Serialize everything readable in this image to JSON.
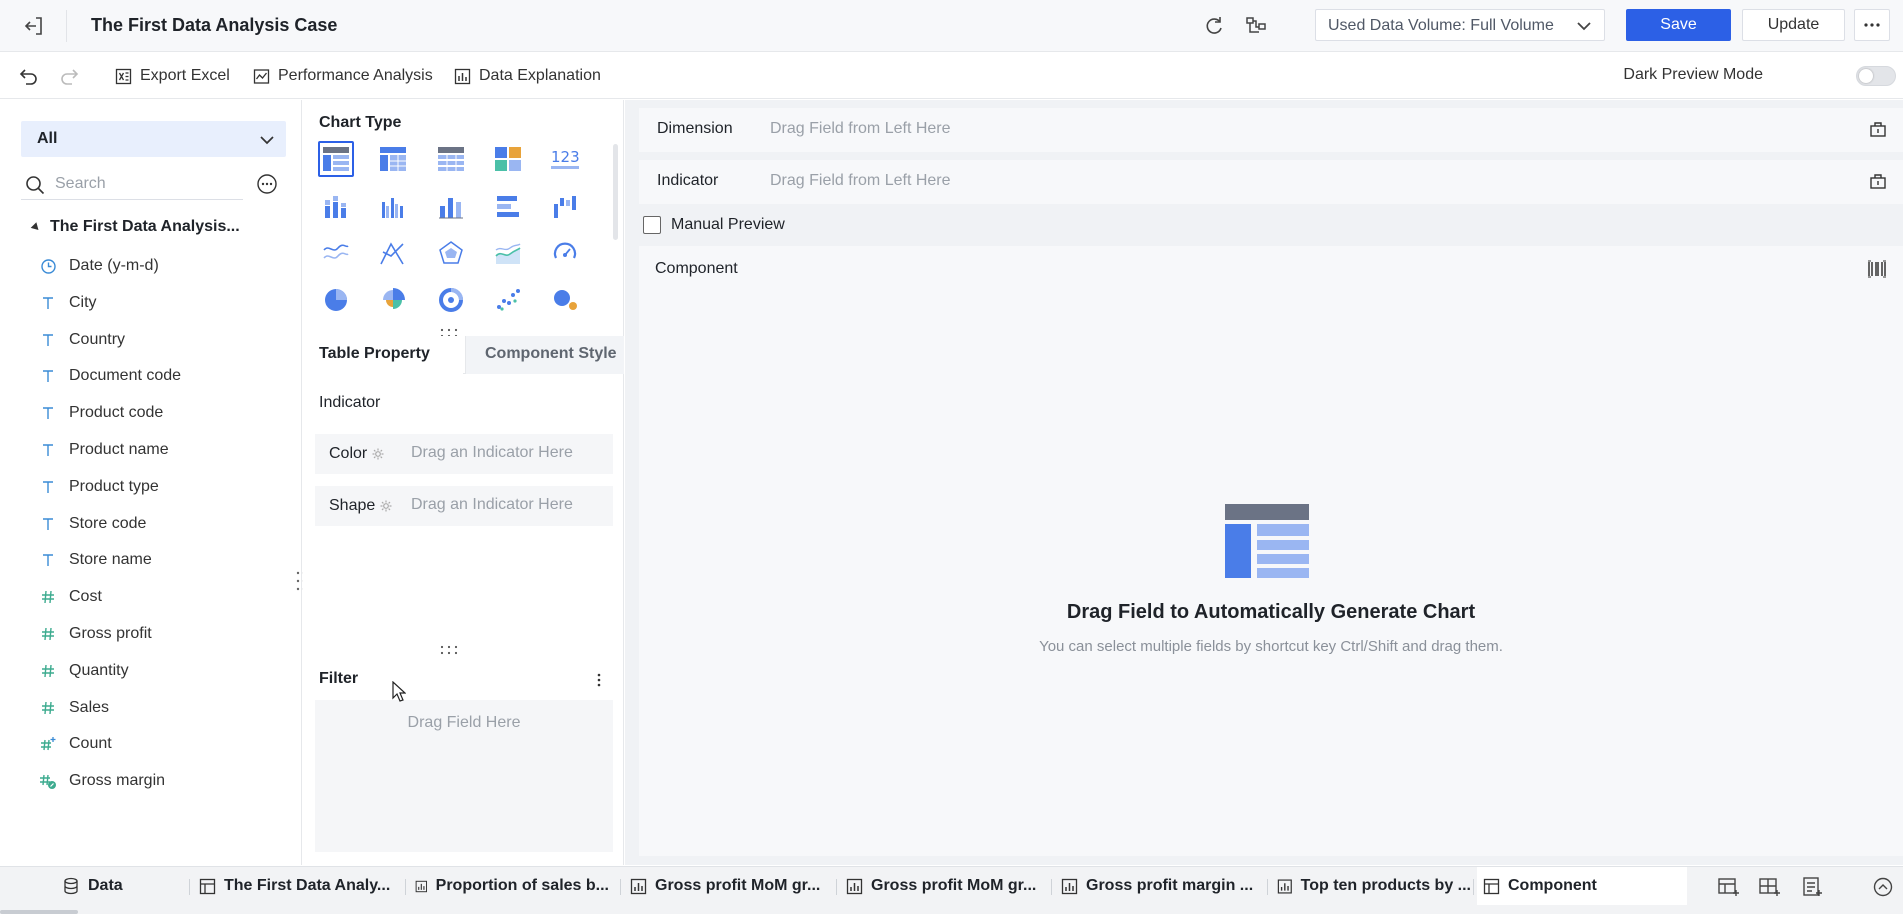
{
  "header": {
    "title": "The First Data Analysis Case",
    "data_volume_label": "Used Data Volume: Full Volume",
    "save_label": "Save",
    "update_label": "Update"
  },
  "toolbar": {
    "export_excel": "Export Excel",
    "performance_analysis": "Performance Analysis",
    "data_explanation": "Data Explanation",
    "dark_preview_mode": "Dark Preview Mode",
    "dark_preview_enabled": false
  },
  "fields_panel": {
    "datasource_selected": "All",
    "search_placeholder": "Search",
    "table_name": "The First Data Analysis...",
    "fields": [
      {
        "label": "Date (y-m-d)",
        "type": "date",
        "icon": "clock-icon"
      },
      {
        "label": "City",
        "type": "text",
        "icon": "text-type-icon"
      },
      {
        "label": "Country",
        "type": "text",
        "icon": "text-type-icon"
      },
      {
        "label": "Document code",
        "type": "text",
        "icon": "text-type-icon"
      },
      {
        "label": "Product code",
        "type": "text",
        "icon": "text-type-icon"
      },
      {
        "label": "Product name",
        "type": "text",
        "icon": "text-type-icon"
      },
      {
        "label": "Product type",
        "type": "text",
        "icon": "text-type-icon"
      },
      {
        "label": "Store code",
        "type": "text",
        "icon": "text-type-icon"
      },
      {
        "label": "Store name",
        "type": "text",
        "icon": "text-type-icon"
      },
      {
        "label": "Cost",
        "type": "number",
        "icon": "hash-icon"
      },
      {
        "label": "Gross profit",
        "type": "number",
        "icon": "hash-icon"
      },
      {
        "label": "Quantity",
        "type": "number",
        "icon": "hash-icon"
      },
      {
        "label": "Sales",
        "type": "number",
        "icon": "hash-icon"
      },
      {
        "label": "Count",
        "type": "calc-number",
        "icon": "hash-plus-icon"
      },
      {
        "label": "Gross margin",
        "type": "calc-number",
        "icon": "hash-calc-icon"
      }
    ]
  },
  "chart_panel": {
    "chart_type_label": "Chart Type",
    "chart_types": [
      "table-icon",
      "cross-table-icon",
      "detail-table-icon",
      "multi-chart-icon",
      "kpi-number-icon",
      "stacked-column-icon",
      "grouped-column-icon",
      "column-icon",
      "bar-icon",
      "waterfall-icon",
      "line-icon",
      "radar-line-icon",
      "radar-icon",
      "area-icon",
      "gauge-icon",
      "pie-icon",
      "rose-pie-icon",
      "donut-icon",
      "scatter-icon",
      "bubble-icon"
    ],
    "selected_chart_type": "table-icon",
    "tab_table_property": "Table Property",
    "tab_component_style": "Component Style",
    "indicator_label": "Indicator",
    "color_label": "Color",
    "color_placeholder": "Drag an Indicator Here",
    "shape_label": "Shape",
    "shape_placeholder": "Drag an Indicator Here",
    "filter_label": "Filter",
    "filter_placeholder": "Drag Field Here"
  },
  "analysis_area": {
    "dimension_label": "Dimension",
    "dimension_placeholder": "Drag Field from Left Here",
    "indicator_label": "Indicator",
    "indicator_placeholder": "Drag Field from Left Here",
    "manual_preview_label": "Manual Preview",
    "manual_preview_checked": false,
    "component_label": "Component",
    "empty_title": "Drag Field to Automatically Generate Chart",
    "empty_subtitle": "You can select multiple fields by shortcut key Ctrl/Shift and drag them."
  },
  "bottom_tabs": [
    {
      "label": "Data",
      "icon": "database-icon",
      "active": false
    },
    {
      "label": "The First Data Analy...",
      "icon": "table-icon",
      "active": false
    },
    {
      "label": "Proportion of sales b...",
      "icon": "chart-icon",
      "active": false
    },
    {
      "label": "Gross profit MoM gr...",
      "icon": "chart-icon",
      "active": false
    },
    {
      "label": "Gross profit MoM gr...",
      "icon": "chart-icon",
      "active": false
    },
    {
      "label": "Gross profit margin ...",
      "icon": "chart-icon",
      "active": false
    },
    {
      "label": "Top ten products by ...",
      "icon": "chart-icon",
      "active": false
    },
    {
      "label": "Component",
      "icon": "table-icon",
      "active": true
    }
  ],
  "colors": {
    "accent": "#2c60e6",
    "field_icon": "#3a8bd6",
    "chart_blue": "#4a7de8",
    "chart_teal": "#4bc0a8"
  }
}
